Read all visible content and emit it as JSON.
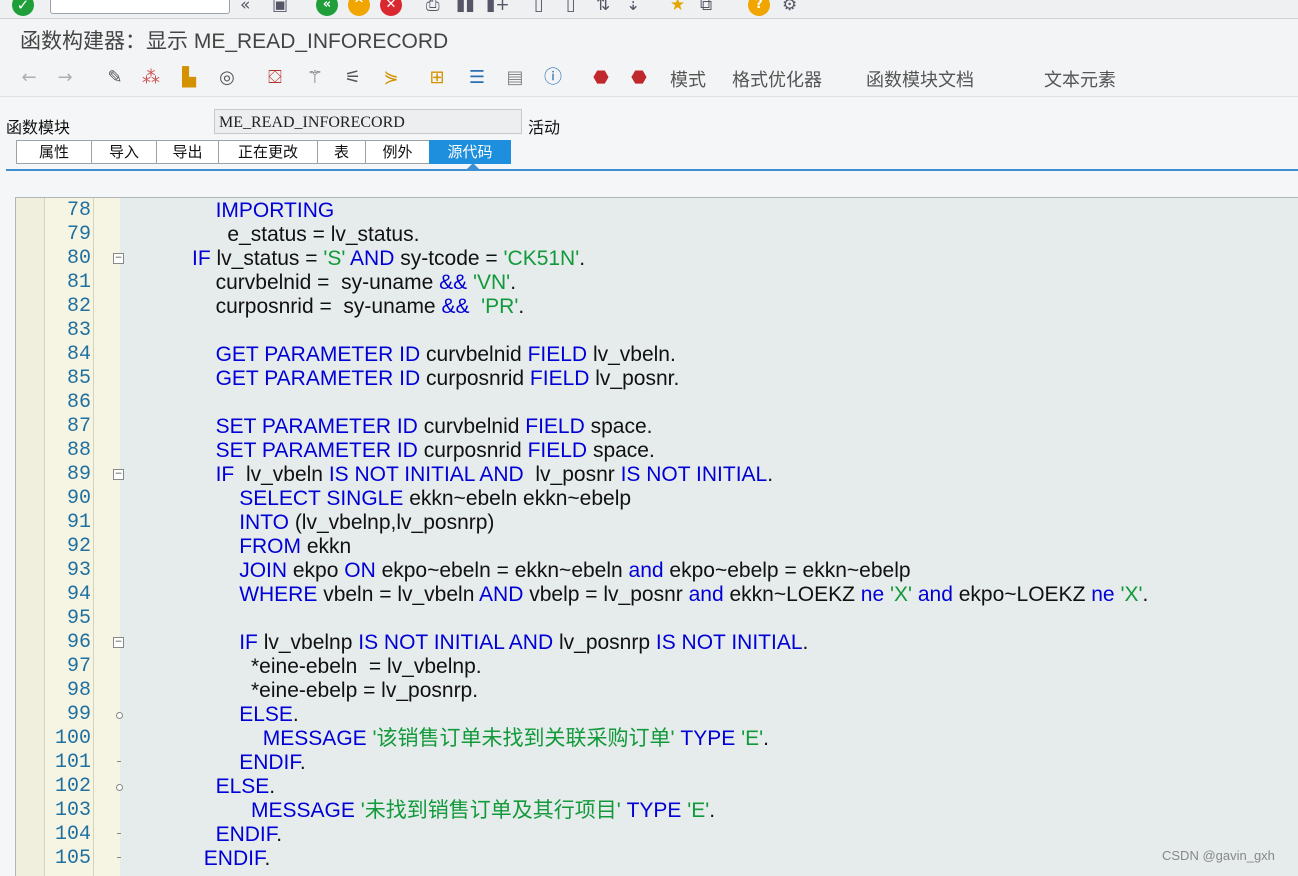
{
  "window_title": "函数构建器：显示 ME_READ_INFORECORD",
  "app_toolbar": {
    "buttons": [
      "模式",
      "格式优化器",
      "函数模块文档",
      "文本元素"
    ]
  },
  "function_module": {
    "label": "函数模块",
    "name": "ME_READ_INFORECORD",
    "status": "活动"
  },
  "tabs": [
    {
      "label": "属性",
      "active": false
    },
    {
      "label": "导入",
      "active": false
    },
    {
      "label": "导出",
      "active": false
    },
    {
      "label": "正在更改",
      "active": false
    },
    {
      "label": "表",
      "active": false
    },
    {
      "label": "例外",
      "active": false
    },
    {
      "label": "源代码",
      "active": true
    }
  ],
  "code_lines": [
    {
      "n": "78",
      "ind": 7,
      "mark": "",
      "seg": [
        [
          "k",
          "IMPORTING"
        ]
      ]
    },
    {
      "n": "79",
      "ind": 8,
      "mark": "",
      "seg": [
        [
          "p",
          "e_status = lv_status."
        ]
      ]
    },
    {
      "n": "80",
      "ind": 5,
      "mark": "fold",
      "seg": [
        [
          "k",
          "IF "
        ],
        [
          "p",
          "lv_status = "
        ],
        [
          "s",
          "'S'"
        ],
        [
          "k",
          " AND "
        ],
        [
          "p",
          "sy-tcode = "
        ],
        [
          "s",
          "'CK51N'"
        ],
        [
          "p",
          "."
        ]
      ]
    },
    {
      "n": "81",
      "ind": 7,
      "mark": "",
      "seg": [
        [
          "p",
          "curvbelnid =  sy-uname "
        ],
        [
          "k",
          "&& "
        ],
        [
          "s",
          "'VN'"
        ],
        [
          "p",
          "."
        ]
      ]
    },
    {
      "n": "82",
      "ind": 7,
      "mark": "",
      "seg": [
        [
          "p",
          "curposnrid =  sy-uname "
        ],
        [
          "k",
          "&&  "
        ],
        [
          "s",
          "'PR'"
        ],
        [
          "p",
          "."
        ]
      ]
    },
    {
      "n": "83",
      "ind": 0,
      "mark": "",
      "seg": []
    },
    {
      "n": "84",
      "ind": 7,
      "mark": "",
      "seg": [
        [
          "k",
          "GET PARAMETER ID "
        ],
        [
          "p",
          "curvbelnid "
        ],
        [
          "k",
          "FIELD "
        ],
        [
          "p",
          "lv_vbeln."
        ]
      ]
    },
    {
      "n": "85",
      "ind": 7,
      "mark": "",
      "seg": [
        [
          "k",
          "GET PARAMETER ID "
        ],
        [
          "p",
          "curposnrid "
        ],
        [
          "k",
          "FIELD "
        ],
        [
          "p",
          "lv_posnr."
        ]
      ]
    },
    {
      "n": "86",
      "ind": 0,
      "mark": "",
      "seg": []
    },
    {
      "n": "87",
      "ind": 7,
      "mark": "",
      "seg": [
        [
          "k",
          "SET PARAMETER ID "
        ],
        [
          "p",
          "curvbelnid "
        ],
        [
          "k",
          "FIELD "
        ],
        [
          "p",
          "space."
        ]
      ]
    },
    {
      "n": "88",
      "ind": 7,
      "mark": "",
      "seg": [
        [
          "k",
          "SET PARAMETER ID "
        ],
        [
          "p",
          "curposnrid "
        ],
        [
          "k",
          "FIELD "
        ],
        [
          "p",
          "space."
        ]
      ]
    },
    {
      "n": "89",
      "ind": 7,
      "mark": "fold",
      "seg": [
        [
          "k",
          "IF  "
        ],
        [
          "p",
          "lv_vbeln "
        ],
        [
          "k",
          "IS NOT INITIAL AND  "
        ],
        [
          "p",
          "lv_posnr "
        ],
        [
          "k",
          "IS NOT INITIAL"
        ],
        [
          "p",
          "."
        ]
      ]
    },
    {
      "n": "90",
      "ind": 9,
      "mark": "",
      "seg": [
        [
          "k",
          "SELECT SINGLE "
        ],
        [
          "p",
          "ekkn~ebeln ekkn~ebelp"
        ]
      ]
    },
    {
      "n": "91",
      "ind": 9,
      "mark": "",
      "seg": [
        [
          "k",
          "INTO "
        ],
        [
          "p",
          "(lv_vbelnp,lv_posnrp)"
        ]
      ]
    },
    {
      "n": "92",
      "ind": 9,
      "mark": "",
      "seg": [
        [
          "k",
          "FROM "
        ],
        [
          "p",
          "ekkn"
        ]
      ]
    },
    {
      "n": "93",
      "ind": 9,
      "mark": "",
      "seg": [
        [
          "k",
          "JOIN "
        ],
        [
          "p",
          "ekpo "
        ],
        [
          "k",
          "ON "
        ],
        [
          "p",
          "ekpo~ebeln = ekkn~ebeln "
        ],
        [
          "k",
          "and "
        ],
        [
          "p",
          "ekpo~ebelp = ekkn~ebelp"
        ]
      ]
    },
    {
      "n": "94",
      "ind": 9,
      "mark": "",
      "seg": [
        [
          "k",
          "WHERE "
        ],
        [
          "p",
          "vbeln = lv_vbeln "
        ],
        [
          "k",
          "AND "
        ],
        [
          "p",
          "vbelp = lv_posnr "
        ],
        [
          "k",
          "and "
        ],
        [
          "p",
          "ekkn~LOEKZ "
        ],
        [
          "k",
          "ne "
        ],
        [
          "s",
          "'X'"
        ],
        [
          "k",
          " and "
        ],
        [
          "p",
          "ekpo~LOEKZ "
        ],
        [
          "k",
          "ne "
        ],
        [
          "s",
          "'X'"
        ],
        [
          "p",
          "."
        ]
      ]
    },
    {
      "n": "95",
      "ind": 0,
      "mark": "",
      "seg": []
    },
    {
      "n": "96",
      "ind": 9,
      "mark": "fold",
      "seg": [
        [
          "k",
          "IF "
        ],
        [
          "p",
          "lv_vbelnp "
        ],
        [
          "k",
          "IS NOT INITIAL AND "
        ],
        [
          "p",
          "lv_posnrp "
        ],
        [
          "k",
          "IS NOT INITIAL"
        ],
        [
          "p",
          "."
        ]
      ]
    },
    {
      "n": "97",
      "ind": 10,
      "mark": "",
      "seg": [
        [
          "p",
          "*eine-ebeln  = lv_vbelnp."
        ]
      ]
    },
    {
      "n": "98",
      "ind": 10,
      "mark": "",
      "seg": [
        [
          "p",
          "*eine-ebelp = lv_posnrp."
        ]
      ]
    },
    {
      "n": "99",
      "ind": 9,
      "mark": "dot",
      "seg": [
        [
          "k",
          "ELSE"
        ],
        [
          "p",
          "."
        ]
      ]
    },
    {
      "n": "100",
      "ind": 11,
      "mark": "",
      "seg": [
        [
          "k",
          "MESSAGE "
        ],
        [
          "s",
          "'该销售订单未找到关联采购订单'"
        ],
        [
          "k",
          " TYPE "
        ],
        [
          "s",
          "'E'"
        ],
        [
          "p",
          "."
        ]
      ]
    },
    {
      "n": "101",
      "ind": 9,
      "mark": "tick",
      "seg": [
        [
          "k",
          "ENDIF"
        ],
        [
          "p",
          "."
        ]
      ]
    },
    {
      "n": "102",
      "ind": 7,
      "mark": "dot",
      "seg": [
        [
          "k",
          "ELSE"
        ],
        [
          "p",
          "."
        ]
      ]
    },
    {
      "n": "103",
      "ind": 10,
      "mark": "",
      "seg": [
        [
          "k",
          "MESSAGE "
        ],
        [
          "s",
          "'未找到销售订单及其行项目'"
        ],
        [
          "k",
          " TYPE "
        ],
        [
          "s",
          "'E'"
        ],
        [
          "p",
          "."
        ]
      ]
    },
    {
      "n": "104",
      "ind": 7,
      "mark": "tick",
      "seg": [
        [
          "k",
          "ENDIF"
        ],
        [
          "p",
          "."
        ]
      ]
    },
    {
      "n": "105",
      "ind": 6,
      "mark": "tick",
      "seg": [
        [
          "k",
          "ENDIF"
        ],
        [
          "p",
          "."
        ]
      ]
    }
  ],
  "watermark": "CSDN @gavin_gxh"
}
